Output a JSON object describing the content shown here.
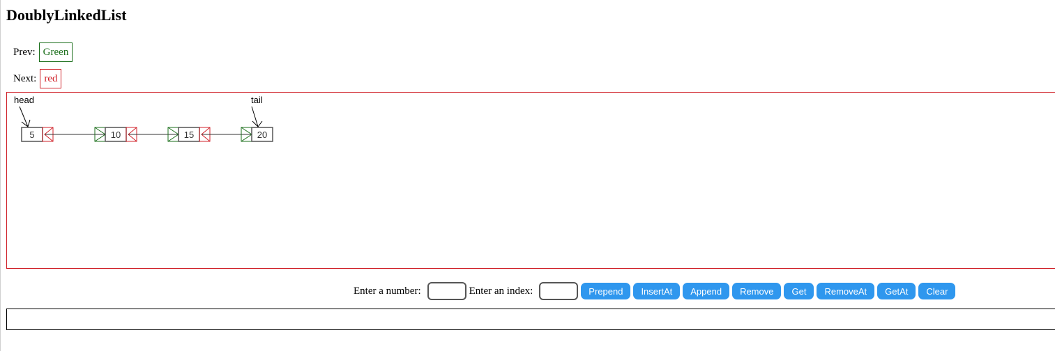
{
  "page": {
    "title": "DoublyLinkedList"
  },
  "legend": {
    "prev_label": "Prev:",
    "prev_value": "Green",
    "next_label": "Next:",
    "next_value": "red"
  },
  "colors": {
    "prev_pointer": "#1a6e1a",
    "next_pointer": "#d0222a",
    "node_border": "#555555",
    "button_bg": "#2f97ee"
  },
  "list": {
    "head_label": "head",
    "tail_label": "tail",
    "nodes": [
      "5",
      "10",
      "15",
      "20"
    ]
  },
  "controls": {
    "number_label": "Enter a number:",
    "number_value": "",
    "index_label": "Enter an index:",
    "index_value": "",
    "buttons": [
      "Prepend",
      "InsertAt",
      "Append",
      "Remove",
      "Get",
      "RemoveAt",
      "GetAt",
      "Clear"
    ]
  },
  "output": {
    "text": ""
  }
}
